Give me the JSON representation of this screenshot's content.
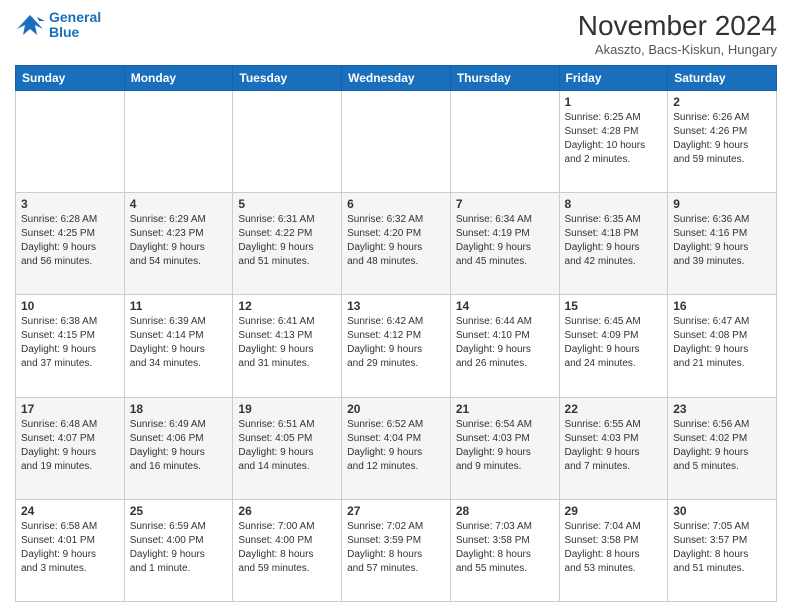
{
  "header": {
    "logo_line1": "General",
    "logo_line2": "Blue",
    "month_title": "November 2024",
    "location": "Akaszto, Bacs-Kiskun, Hungary"
  },
  "weekdays": [
    "Sunday",
    "Monday",
    "Tuesday",
    "Wednesday",
    "Thursday",
    "Friday",
    "Saturday"
  ],
  "weeks": [
    [
      {
        "day": "",
        "info": ""
      },
      {
        "day": "",
        "info": ""
      },
      {
        "day": "",
        "info": ""
      },
      {
        "day": "",
        "info": ""
      },
      {
        "day": "",
        "info": ""
      },
      {
        "day": "1",
        "info": "Sunrise: 6:25 AM\nSunset: 4:28 PM\nDaylight: 10 hours\nand 2 minutes."
      },
      {
        "day": "2",
        "info": "Sunrise: 6:26 AM\nSunset: 4:26 PM\nDaylight: 9 hours\nand 59 minutes."
      }
    ],
    [
      {
        "day": "3",
        "info": "Sunrise: 6:28 AM\nSunset: 4:25 PM\nDaylight: 9 hours\nand 56 minutes."
      },
      {
        "day": "4",
        "info": "Sunrise: 6:29 AM\nSunset: 4:23 PM\nDaylight: 9 hours\nand 54 minutes."
      },
      {
        "day": "5",
        "info": "Sunrise: 6:31 AM\nSunset: 4:22 PM\nDaylight: 9 hours\nand 51 minutes."
      },
      {
        "day": "6",
        "info": "Sunrise: 6:32 AM\nSunset: 4:20 PM\nDaylight: 9 hours\nand 48 minutes."
      },
      {
        "day": "7",
        "info": "Sunrise: 6:34 AM\nSunset: 4:19 PM\nDaylight: 9 hours\nand 45 minutes."
      },
      {
        "day": "8",
        "info": "Sunrise: 6:35 AM\nSunset: 4:18 PM\nDaylight: 9 hours\nand 42 minutes."
      },
      {
        "day": "9",
        "info": "Sunrise: 6:36 AM\nSunset: 4:16 PM\nDaylight: 9 hours\nand 39 minutes."
      }
    ],
    [
      {
        "day": "10",
        "info": "Sunrise: 6:38 AM\nSunset: 4:15 PM\nDaylight: 9 hours\nand 37 minutes."
      },
      {
        "day": "11",
        "info": "Sunrise: 6:39 AM\nSunset: 4:14 PM\nDaylight: 9 hours\nand 34 minutes."
      },
      {
        "day": "12",
        "info": "Sunrise: 6:41 AM\nSunset: 4:13 PM\nDaylight: 9 hours\nand 31 minutes."
      },
      {
        "day": "13",
        "info": "Sunrise: 6:42 AM\nSunset: 4:12 PM\nDaylight: 9 hours\nand 29 minutes."
      },
      {
        "day": "14",
        "info": "Sunrise: 6:44 AM\nSunset: 4:10 PM\nDaylight: 9 hours\nand 26 minutes."
      },
      {
        "day": "15",
        "info": "Sunrise: 6:45 AM\nSunset: 4:09 PM\nDaylight: 9 hours\nand 24 minutes."
      },
      {
        "day": "16",
        "info": "Sunrise: 6:47 AM\nSunset: 4:08 PM\nDaylight: 9 hours\nand 21 minutes."
      }
    ],
    [
      {
        "day": "17",
        "info": "Sunrise: 6:48 AM\nSunset: 4:07 PM\nDaylight: 9 hours\nand 19 minutes."
      },
      {
        "day": "18",
        "info": "Sunrise: 6:49 AM\nSunset: 4:06 PM\nDaylight: 9 hours\nand 16 minutes."
      },
      {
        "day": "19",
        "info": "Sunrise: 6:51 AM\nSunset: 4:05 PM\nDaylight: 9 hours\nand 14 minutes."
      },
      {
        "day": "20",
        "info": "Sunrise: 6:52 AM\nSunset: 4:04 PM\nDaylight: 9 hours\nand 12 minutes."
      },
      {
        "day": "21",
        "info": "Sunrise: 6:54 AM\nSunset: 4:03 PM\nDaylight: 9 hours\nand 9 minutes."
      },
      {
        "day": "22",
        "info": "Sunrise: 6:55 AM\nSunset: 4:03 PM\nDaylight: 9 hours\nand 7 minutes."
      },
      {
        "day": "23",
        "info": "Sunrise: 6:56 AM\nSunset: 4:02 PM\nDaylight: 9 hours\nand 5 minutes."
      }
    ],
    [
      {
        "day": "24",
        "info": "Sunrise: 6:58 AM\nSunset: 4:01 PM\nDaylight: 9 hours\nand 3 minutes."
      },
      {
        "day": "25",
        "info": "Sunrise: 6:59 AM\nSunset: 4:00 PM\nDaylight: 9 hours\nand 1 minute."
      },
      {
        "day": "26",
        "info": "Sunrise: 7:00 AM\nSunset: 4:00 PM\nDaylight: 8 hours\nand 59 minutes."
      },
      {
        "day": "27",
        "info": "Sunrise: 7:02 AM\nSunset: 3:59 PM\nDaylight: 8 hours\nand 57 minutes."
      },
      {
        "day": "28",
        "info": "Sunrise: 7:03 AM\nSunset: 3:58 PM\nDaylight: 8 hours\nand 55 minutes."
      },
      {
        "day": "29",
        "info": "Sunrise: 7:04 AM\nSunset: 3:58 PM\nDaylight: 8 hours\nand 53 minutes."
      },
      {
        "day": "30",
        "info": "Sunrise: 7:05 AM\nSunset: 3:57 PM\nDaylight: 8 hours\nand 51 minutes."
      }
    ]
  ]
}
